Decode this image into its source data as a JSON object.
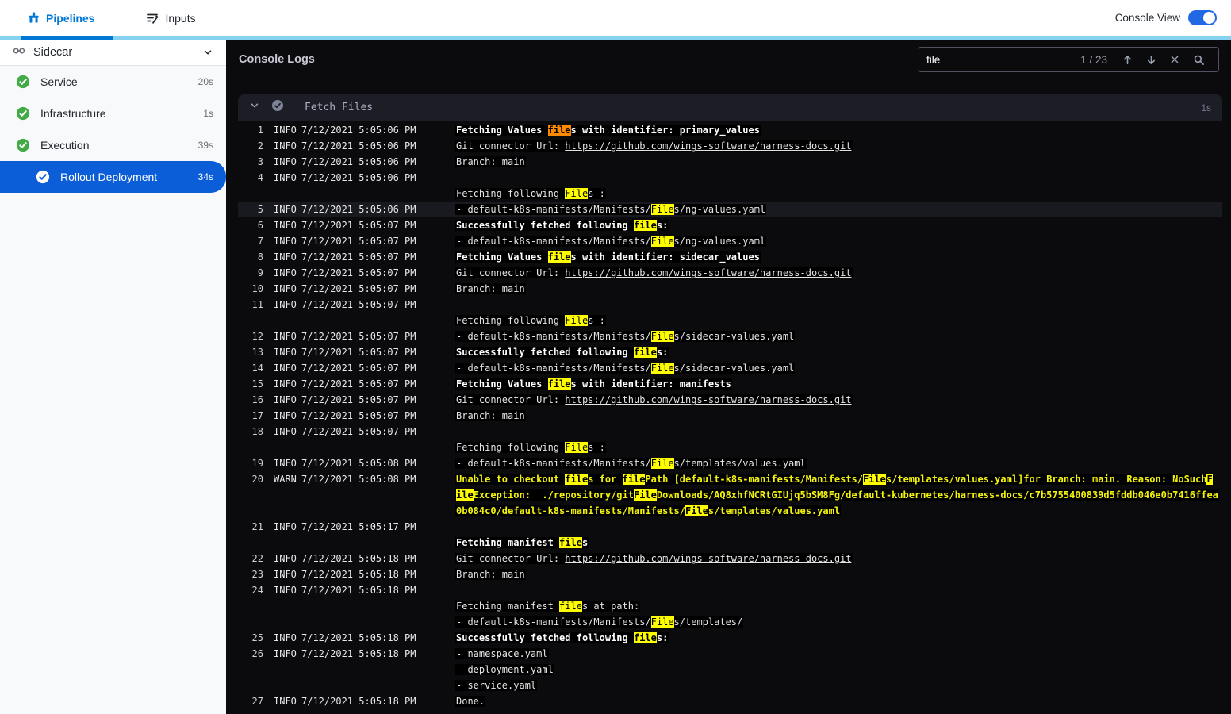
{
  "topbar": {
    "tabs": [
      {
        "label": "Pipelines",
        "active": true
      },
      {
        "label": "Inputs",
        "active": false
      }
    ],
    "console_view_label": "Console View",
    "console_view_on": true
  },
  "sidebar": {
    "group_label": "Sidecar",
    "items": [
      {
        "label": "Service",
        "duration": "20s",
        "status": "success",
        "selected": false
      },
      {
        "label": "Infrastructure",
        "duration": "1s",
        "status": "success",
        "selected": false
      },
      {
        "label": "Execution",
        "duration": "39s",
        "status": "success",
        "selected": false
      },
      {
        "label": "Rollout Deployment",
        "duration": "34s",
        "status": "success",
        "selected": true
      }
    ]
  },
  "console": {
    "title": "Console Logs",
    "search": {
      "value": "file",
      "counter": "1 / 23"
    },
    "section": {
      "title": "Fetch Files",
      "duration": "1s"
    },
    "colors": {
      "accent_blue": "#0278d5",
      "selected_row_blue": "#0b5ed7",
      "success_green": "#42ab45",
      "match_highlight": "#fdfd00",
      "active_match_highlight": "#ff8a00",
      "warn_text": "#f2f20c"
    },
    "rows": [
      {
        "num": "1",
        "level": "INFO",
        "time": "7/12/2021 5:05:06 PM",
        "selected": false,
        "lines": [
          {
            "bold": true,
            "segs": [
              {
                "t": "Fetching Values "
              },
              {
                "t": "file",
                "hl": "active"
              },
              {
                "t": "s with identifier: primary_values"
              }
            ]
          }
        ]
      },
      {
        "num": "2",
        "level": "INFO",
        "time": "7/12/2021 5:05:06 PM",
        "selected": false,
        "lines": [
          {
            "segs": [
              {
                "t": "Git connector Url: "
              },
              {
                "t": "https://github.com/wings-software/harness-docs.git",
                "link": true
              }
            ]
          }
        ]
      },
      {
        "num": "3",
        "level": "INFO",
        "time": "7/12/2021 5:05:06 PM",
        "selected": false,
        "lines": [
          {
            "segs": [
              {
                "t": "Branch: main"
              }
            ]
          }
        ]
      },
      {
        "num": "4",
        "level": "INFO",
        "time": "7/12/2021 5:05:06 PM",
        "selected": false,
        "lines": [
          {
            "segs": []
          },
          {
            "segs": [
              {
                "t": "Fetching following "
              },
              {
                "t": "File",
                "hl": "match"
              },
              {
                "t": "s :"
              }
            ]
          }
        ]
      },
      {
        "num": "5",
        "level": "INFO",
        "time": "7/12/2021 5:05:06 PM",
        "selected": true,
        "lines": [
          {
            "segs": [
              {
                "t": "- default-k8s-manifests/Manifests/"
              },
              {
                "t": "File",
                "hl": "match"
              },
              {
                "t": "s/ng-values.yaml"
              }
            ]
          }
        ]
      },
      {
        "num": "6",
        "level": "INFO",
        "time": "7/12/2021 5:05:07 PM",
        "selected": false,
        "lines": [
          {
            "bold": true,
            "segs": [
              {
                "t": "Successfully fetched following "
              },
              {
                "t": "file",
                "hl": "match"
              },
              {
                "t": "s:"
              }
            ]
          }
        ]
      },
      {
        "num": "7",
        "level": "INFO",
        "time": "7/12/2021 5:05:07 PM",
        "selected": false,
        "lines": [
          {
            "segs": [
              {
                "t": "- default-k8s-manifests/Manifests/"
              },
              {
                "t": "File",
                "hl": "match"
              },
              {
                "t": "s/ng-values.yaml"
              }
            ]
          }
        ]
      },
      {
        "num": "8",
        "level": "INFO",
        "time": "7/12/2021 5:05:07 PM",
        "selected": false,
        "lines": [
          {
            "bold": true,
            "segs": [
              {
                "t": "Fetching Values "
              },
              {
                "t": "file",
                "hl": "match"
              },
              {
                "t": "s with identifier: sidecar_values"
              }
            ]
          }
        ]
      },
      {
        "num": "9",
        "level": "INFO",
        "time": "7/12/2021 5:05:07 PM",
        "selected": false,
        "lines": [
          {
            "segs": [
              {
                "t": "Git connector Url: "
              },
              {
                "t": "https://github.com/wings-software/harness-docs.git",
                "link": true
              }
            ]
          }
        ]
      },
      {
        "num": "10",
        "level": "INFO",
        "time": "7/12/2021 5:05:07 PM",
        "selected": false,
        "lines": [
          {
            "segs": [
              {
                "t": "Branch: main"
              }
            ]
          }
        ]
      },
      {
        "num": "11",
        "level": "INFO",
        "time": "7/12/2021 5:05:07 PM",
        "selected": false,
        "lines": [
          {
            "segs": []
          },
          {
            "segs": [
              {
                "t": "Fetching following "
              },
              {
                "t": "File",
                "hl": "match"
              },
              {
                "t": "s :"
              }
            ]
          }
        ]
      },
      {
        "num": "12",
        "level": "INFO",
        "time": "7/12/2021 5:05:07 PM",
        "selected": false,
        "lines": [
          {
            "segs": [
              {
                "t": "- default-k8s-manifests/Manifests/"
              },
              {
                "t": "File",
                "hl": "match"
              },
              {
                "t": "s/sidecar-values.yaml"
              }
            ]
          }
        ]
      },
      {
        "num": "13",
        "level": "INFO",
        "time": "7/12/2021 5:05:07 PM",
        "selected": false,
        "lines": [
          {
            "bold": true,
            "segs": [
              {
                "t": "Successfully fetched following "
              },
              {
                "t": "file",
                "hl": "match"
              },
              {
                "t": "s:"
              }
            ]
          }
        ]
      },
      {
        "num": "14",
        "level": "INFO",
        "time": "7/12/2021 5:05:07 PM",
        "selected": false,
        "lines": [
          {
            "segs": [
              {
                "t": "- default-k8s-manifests/Manifests/"
              },
              {
                "t": "File",
                "hl": "match"
              },
              {
                "t": "s/sidecar-values.yaml"
              }
            ]
          }
        ]
      },
      {
        "num": "15",
        "level": "INFO",
        "time": "7/12/2021 5:05:07 PM",
        "selected": false,
        "lines": [
          {
            "bold": true,
            "segs": [
              {
                "t": "Fetching Values "
              },
              {
                "t": "file",
                "hl": "match"
              },
              {
                "t": "s with identifier: manifests"
              }
            ]
          }
        ]
      },
      {
        "num": "16",
        "level": "INFO",
        "time": "7/12/2021 5:05:07 PM",
        "selected": false,
        "lines": [
          {
            "segs": [
              {
                "t": "Git connector Url: "
              },
              {
                "t": "https://github.com/wings-software/harness-docs.git",
                "link": true
              }
            ]
          }
        ]
      },
      {
        "num": "17",
        "level": "INFO",
        "time": "7/12/2021 5:05:07 PM",
        "selected": false,
        "lines": [
          {
            "segs": [
              {
                "t": "Branch: main"
              }
            ]
          }
        ]
      },
      {
        "num": "18",
        "level": "INFO",
        "time": "7/12/2021 5:05:07 PM",
        "selected": false,
        "lines": [
          {
            "segs": []
          },
          {
            "segs": [
              {
                "t": "Fetching following "
              },
              {
                "t": "File",
                "hl": "match"
              },
              {
                "t": "s :"
              }
            ]
          }
        ]
      },
      {
        "num": "19",
        "level": "INFO",
        "time": "7/12/2021 5:05:08 PM",
        "selected": false,
        "lines": [
          {
            "segs": [
              {
                "t": "- default-k8s-manifests/Manifests/"
              },
              {
                "t": "File",
                "hl": "match"
              },
              {
                "t": "s/templates/values.yaml"
              }
            ]
          }
        ]
      },
      {
        "num": "20",
        "level": "WARN",
        "time": "7/12/2021 5:05:08 PM",
        "selected": false,
        "lines": [
          {
            "warn": true,
            "segs": [
              {
                "t": "Unable to checkout "
              },
              {
                "t": "file",
                "hl": "match"
              },
              {
                "t": "s for "
              },
              {
                "t": "file",
                "hl": "match"
              },
              {
                "t": "Path [default-k8s-manifests/Manifests/"
              },
              {
                "t": "File",
                "hl": "match"
              },
              {
                "t": "s/templates/values.yaml]for Branch: main. Reason: NoSuch"
              },
              {
                "t": "F",
                "hl": "match"
              }
            ]
          },
          {
            "warn": true,
            "segs": [
              {
                "t": "ile",
                "hl": "match"
              },
              {
                "t": "Exception:  ./repository/git"
              },
              {
                "t": "File",
                "hl": "match"
              },
              {
                "t": "Downloads/AQ8xhfNCRtGIUjq5bSM8Fg/default-kubernetes/harness-docs/c7b5755400839d5fddb046e0b7416ffea"
              }
            ]
          },
          {
            "warn": true,
            "segs": [
              {
                "t": "0b084c0/default-k8s-manifests/Manifests/"
              },
              {
                "t": "File",
                "hl": "match"
              },
              {
                "t": "s/templates/values.yaml"
              }
            ]
          }
        ]
      },
      {
        "num": "21",
        "level": "INFO",
        "time": "7/12/2021 5:05:17 PM",
        "selected": false,
        "lines": [
          {
            "segs": []
          },
          {
            "bold": true,
            "segs": [
              {
                "t": "Fetching manifest "
              },
              {
                "t": "file",
                "hl": "match"
              },
              {
                "t": "s"
              }
            ]
          }
        ]
      },
      {
        "num": "22",
        "level": "INFO",
        "time": "7/12/2021 5:05:18 PM",
        "selected": false,
        "lines": [
          {
            "segs": [
              {
                "t": "Git connector Url: "
              },
              {
                "t": "https://github.com/wings-software/harness-docs.git",
                "link": true
              }
            ]
          }
        ]
      },
      {
        "num": "23",
        "level": "INFO",
        "time": "7/12/2021 5:05:18 PM",
        "selected": false,
        "lines": [
          {
            "segs": [
              {
                "t": "Branch: main"
              }
            ]
          }
        ]
      },
      {
        "num": "24",
        "level": "INFO",
        "time": "7/12/2021 5:05:18 PM",
        "selected": false,
        "lines": [
          {
            "segs": []
          },
          {
            "segs": [
              {
                "t": "Fetching manifest "
              },
              {
                "t": "file",
                "hl": "match"
              },
              {
                "t": "s at path:"
              }
            ]
          },
          {
            "segs": [
              {
                "t": "- default-k8s-manifests/Manifests/"
              },
              {
                "t": "File",
                "hl": "match"
              },
              {
                "t": "s/templates/"
              }
            ]
          }
        ]
      },
      {
        "num": "25",
        "level": "INFO",
        "time": "7/12/2021 5:05:18 PM",
        "selected": false,
        "lines": [
          {
            "bold": true,
            "segs": [
              {
                "t": "Successfully fetched following "
              },
              {
                "t": "file",
                "hl": "match"
              },
              {
                "t": "s:"
              }
            ]
          }
        ]
      },
      {
        "num": "26",
        "level": "INFO",
        "time": "7/12/2021 5:05:18 PM",
        "selected": false,
        "lines": [
          {
            "segs": [
              {
                "t": "- namespace.yaml"
              }
            ]
          },
          {
            "segs": [
              {
                "t": "- deployment.yaml"
              }
            ]
          },
          {
            "segs": [
              {
                "t": "- service.yaml"
              }
            ]
          }
        ]
      },
      {
        "num": "27",
        "level": "INFO",
        "time": "7/12/2021 5:05:18 PM",
        "selected": false,
        "lines": [
          {
            "segs": [
              {
                "t": "Done."
              }
            ]
          }
        ]
      }
    ]
  }
}
